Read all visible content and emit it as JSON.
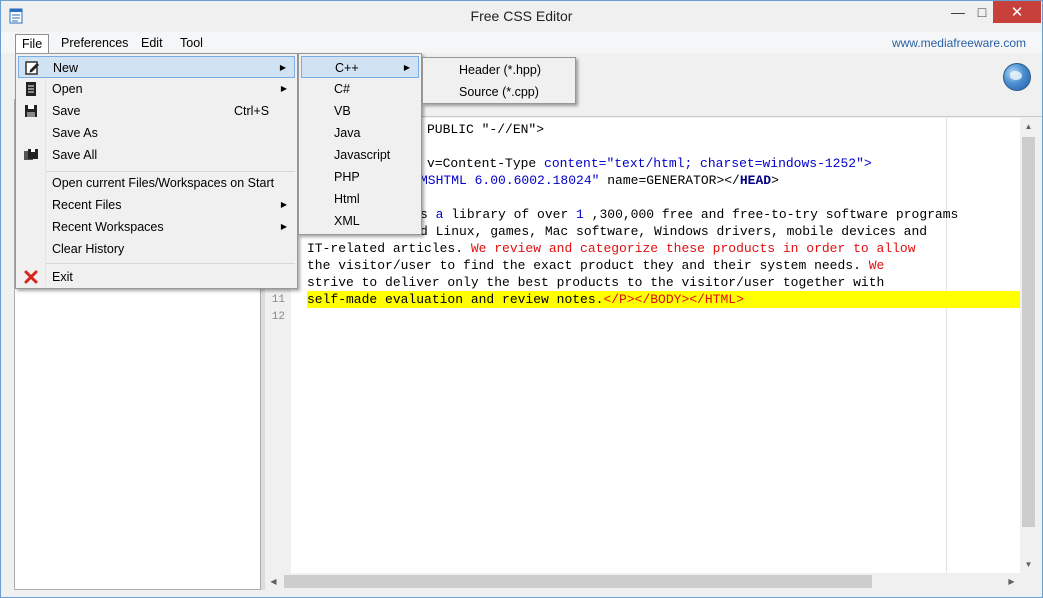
{
  "window": {
    "title": "Free CSS Editor"
  },
  "menubar": {
    "file": "File",
    "preferences": "Preferences",
    "edit": "Edit",
    "tool": "Tool",
    "site": "www.mediafreeware.com"
  },
  "file_menu": {
    "new": "New",
    "open": "Open",
    "save": "Save",
    "save_shortcut": "Ctrl+S",
    "save_as": "Save As",
    "save_all": "Save All",
    "open_current": "Open current Files/Workspaces on Start",
    "recent_files": "Recent Files",
    "recent_workspaces": "Recent Workspaces",
    "clear_history": "Clear History",
    "exit": "Exit"
  },
  "new_menu": [
    "C++",
    "C#",
    "VB",
    "Java",
    "Javascript",
    "PHP",
    "Html",
    "XML"
  ],
  "cpp_menu": [
    "Header (*.hpp)",
    "Source (*.cpp)"
  ],
  "editor": {
    "line_numbers": [
      "11",
      "12"
    ],
    "lines": {
      "l1": "PUBLIC \"-//EN\">",
      "l3a": "v=Content-Type ",
      "l3b": "content",
      "l3c": "=\"text/html; charset=windows-1252\">",
      "l4a": "MSHTML 6.00.6002.18024\"",
      "l4b": " name=GENERATOR></",
      "l4c": "HEAD",
      "l4d": ">",
      "l6a": "s ",
      "l6b": "a",
      "l6c": " library of over ",
      "l6d": "1",
      "l6e": " ,300,000 free and free-to-try software programs",
      "l7": "d Linux, games, Mac software, Windows drivers, mobile devices and",
      "l8a": "IT-related articles. ",
      "l8b": "We review and categorize these products in order to allow",
      "l9a": "the visitor/user to find the exact product they and their system needs. ",
      "l9b": "We",
      "l10": "strive to deliver only the best products to the visitor/user together with",
      "l11a": "self-made evaluation and review notes.",
      "l11b": "</P></BODY></HTML>"
    }
  },
  "colors": {
    "tag_blue": "#0000c8",
    "text_red": "#e01010",
    "highlight": "#ffff00",
    "menu_hover": "#d1e2f2"
  }
}
